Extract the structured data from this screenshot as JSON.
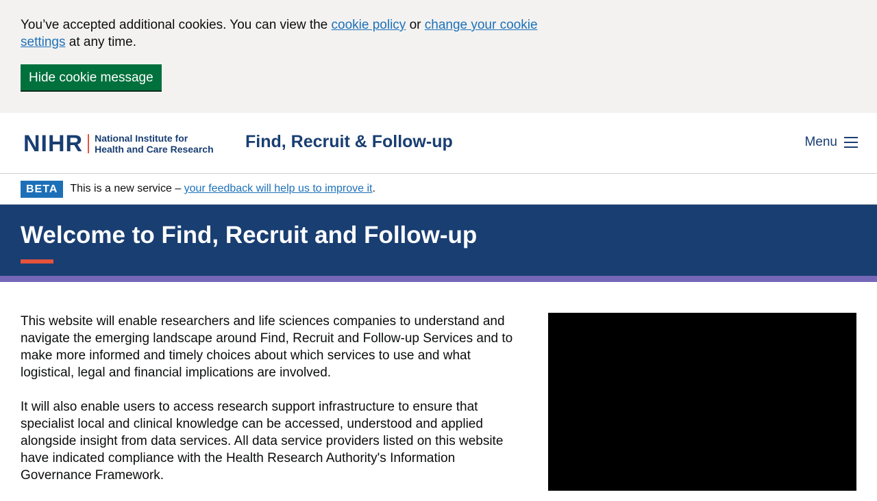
{
  "cookie_banner": {
    "text_before": "You’ve accepted additional cookies. You can view the ",
    "cookie_policy_link": "cookie policy",
    "text_middle": " or ",
    "settings_link": "change your cookie settings",
    "text_after": " at any time.",
    "hide_button": "Hide cookie message"
  },
  "header": {
    "logo_mark": "NIHR",
    "logo_line1": "National Institute for",
    "logo_line2": "Health and Care Research",
    "service_title": "Find, Recruit & Follow-up",
    "menu_label": "Menu"
  },
  "beta_banner": {
    "tag": "BETA",
    "text_before": "This is a new service – ",
    "feedback_link": "your feedback will help us to improve it",
    "text_after": "."
  },
  "hero": {
    "title": "Welcome to Find, Recruit and Follow-up"
  },
  "main": {
    "paragraph1": "This website will enable researchers and life sciences companies to understand and navigate the emerging landscape around Find, Recruit and Follow-up Services and to make more informed and timely choices about which services to use and what logistical, legal and financial implications are involved.",
    "paragraph2": "It will also enable users to access research support infrastructure to ensure that specialist local and clinical knowledge can be accessed, understood and applied alongside insight from data services. All data service providers listed on this website have indicated compliance with the Health Research Authority's Information Governance Framework."
  },
  "colors": {
    "brand_navy": "#193e72",
    "accent_coral": "#e5533d",
    "accent_purple": "#7567b8",
    "link_blue": "#1d70b8",
    "button_green": "#00703c"
  }
}
